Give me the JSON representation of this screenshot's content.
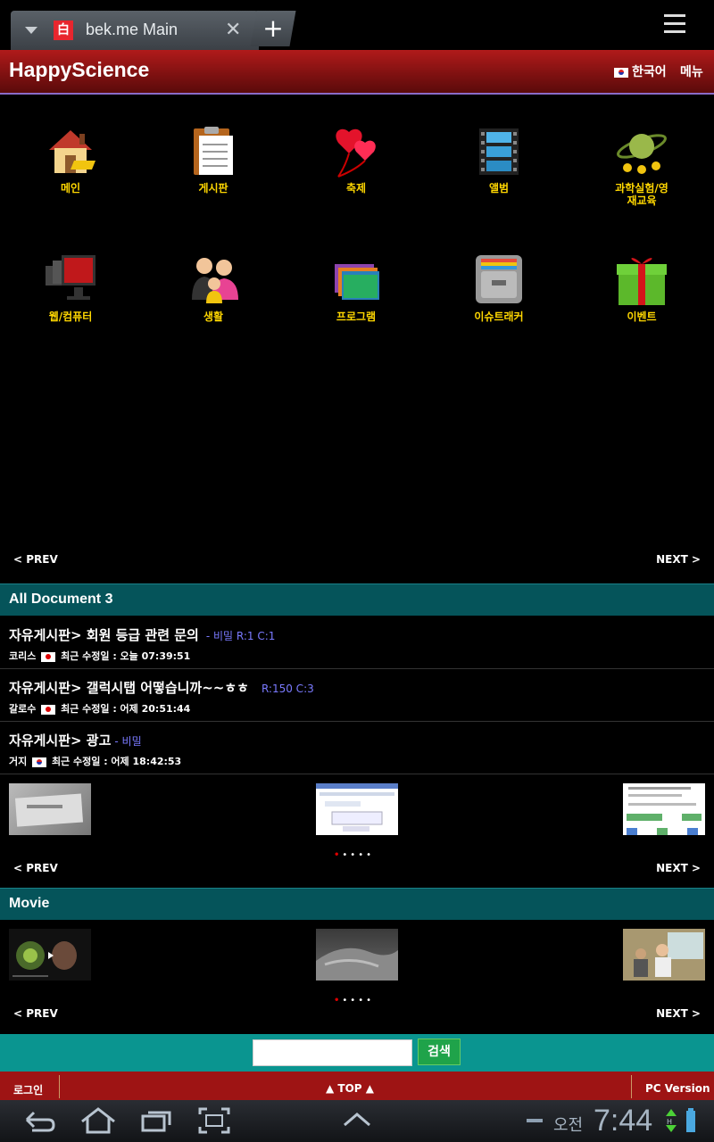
{
  "browser": {
    "tab_title": "bek.me Main",
    "favicon_char": "白",
    "new_tab_label": "+"
  },
  "header": {
    "logo": "HappyScience",
    "language": "한국어",
    "menu": "메뉴"
  },
  "grid": {
    "items": [
      {
        "label": "메인",
        "icon": "house-icon"
      },
      {
        "label": "게시판",
        "icon": "clipboard-icon"
      },
      {
        "label": "축제",
        "icon": "heart-balloons-icon"
      },
      {
        "label": "앨범",
        "icon": "film-strip-icon"
      },
      {
        "label": "과학실험/영재교육",
        "icon": "planet-icon"
      },
      {
        "label": "웹/컴퓨터",
        "icon": "monitors-icon"
      },
      {
        "label": "생활",
        "icon": "family-icon"
      },
      {
        "label": "프로그램",
        "icon": "folders-icon"
      },
      {
        "label": "이슈트래커",
        "icon": "file-cabinet-icon"
      },
      {
        "label": "이벤트",
        "icon": "gift-icon"
      }
    ]
  },
  "pager": {
    "prev": "< PREV",
    "next": "NEXT >"
  },
  "documents": {
    "section_title": "All Document 3",
    "items": [
      {
        "title": "자유게시판> 회원 등급 관련 문의",
        "meta": "- 비밀  R:1  C:1",
        "author": "코리스",
        "modified": "최근 수정일 : 오늘 07:39:51",
        "flag": "jp"
      },
      {
        "title": "자유게시판> 갤럭시탭 어떻습니까~~ㅎㅎ",
        "meta": "R:150  C:3",
        "author": "갈로수",
        "modified": "최근 수정일 : 어제 20:51:44",
        "flag": "jp"
      },
      {
        "title": "자유게시판> 광고",
        "meta": "- 비밀",
        "author": "거지",
        "modified": "최근 수정일 : 어제 18:42:53",
        "flag": "kr"
      }
    ]
  },
  "movie": {
    "section_title": "Movie"
  },
  "search": {
    "button": "검색",
    "value": ""
  },
  "footer": {
    "login": "로그인",
    "top": "▲ TOP ▲",
    "pc_version": "PC Version"
  },
  "statusbar": {
    "ampm": "오전",
    "time": "7:44"
  },
  "colors": {
    "header_red": "#b01a1a",
    "section_teal": "#05545a",
    "search_teal": "#0a9590",
    "label_yellow": "#ffd700",
    "meta_blue": "#7a7aff"
  }
}
